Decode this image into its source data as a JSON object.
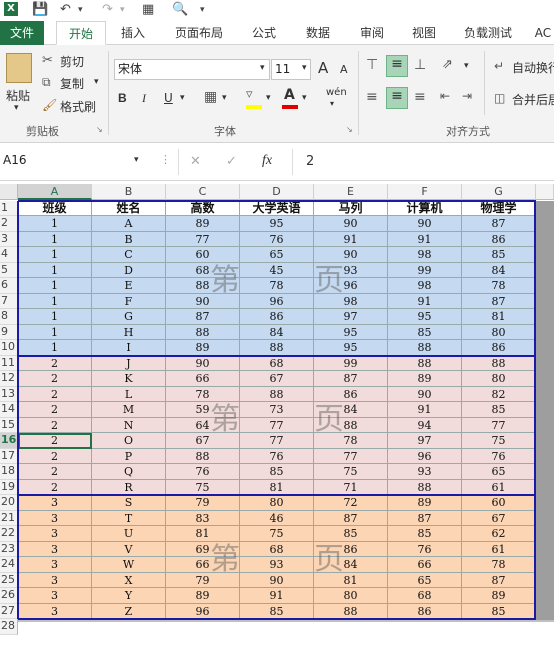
{
  "quick_access": {
    "excel_icon": "excel-app-icon",
    "save_icon": "save-icon",
    "undo_icon": "undo-icon",
    "redo_icon": "redo-icon",
    "print_preview_icon": "print-preview-icon",
    "customize_icon": "customize-qa-icon"
  },
  "tabs": [
    "文件",
    "开始",
    "插入",
    "页面布局",
    "公式",
    "数据",
    "审阅",
    "视图",
    "负载测试",
    "AC"
  ],
  "ribbon": {
    "clipboard": {
      "paste": "粘贴",
      "cut": "剪切",
      "copy": "复制",
      "format_painter": "格式刷",
      "group": "剪贴板"
    },
    "font": {
      "name": "宋体",
      "size": "11",
      "bold": "B",
      "italic": "I",
      "underline": "U",
      "grow": "A",
      "shrink": "A",
      "phonetic": "wén",
      "group": "字体"
    },
    "alignment": {
      "wrap": "自动换行",
      "merge": "合并后居",
      "group": "对齐方式"
    }
  },
  "formula_bar": {
    "name_box": "A16",
    "fx": "fx",
    "value": "2"
  },
  "sheet": {
    "columns": [
      "A",
      "B",
      "C",
      "D",
      "E",
      "F",
      "G"
    ],
    "header_row": [
      "班级",
      "姓名",
      "高数",
      "大学英语",
      "马列",
      "计算机",
      "物理学"
    ],
    "rows": [
      [
        "1",
        "A",
        "89",
        "95",
        "90",
        "90",
        "87"
      ],
      [
        "1",
        "B",
        "77",
        "76",
        "91",
        "91",
        "86"
      ],
      [
        "1",
        "C",
        "60",
        "65",
        "90",
        "98",
        "85"
      ],
      [
        "1",
        "D",
        "68",
        "45",
        "93",
        "99",
        "84"
      ],
      [
        "1",
        "E",
        "88",
        "78",
        "96",
        "98",
        "78"
      ],
      [
        "1",
        "F",
        "90",
        "96",
        "98",
        "91",
        "87"
      ],
      [
        "1",
        "G",
        "87",
        "86",
        "97",
        "95",
        "81"
      ],
      [
        "1",
        "H",
        "88",
        "84",
        "95",
        "85",
        "80"
      ],
      [
        "1",
        "I",
        "89",
        "88",
        "95",
        "88",
        "86"
      ],
      [
        "2",
        "J",
        "90",
        "68",
        "99",
        "88",
        "88"
      ],
      [
        "2",
        "K",
        "66",
        "67",
        "87",
        "89",
        "80"
      ],
      [
        "2",
        "L",
        "78",
        "88",
        "86",
        "90",
        "82"
      ],
      [
        "2",
        "M",
        "59",
        "73",
        "84",
        "91",
        "85"
      ],
      [
        "2",
        "N",
        "64",
        "77",
        "88",
        "94",
        "77"
      ],
      [
        "2",
        "O",
        "67",
        "77",
        "78",
        "97",
        "75"
      ],
      [
        "2",
        "P",
        "88",
        "76",
        "77",
        "96",
        "76"
      ],
      [
        "2",
        "Q",
        "76",
        "85",
        "75",
        "93",
        "65"
      ],
      [
        "2",
        "R",
        "75",
        "81",
        "71",
        "88",
        "61"
      ],
      [
        "3",
        "S",
        "79",
        "80",
        "72",
        "89",
        "60"
      ],
      [
        "3",
        "T",
        "83",
        "46",
        "87",
        "87",
        "67"
      ],
      [
        "3",
        "U",
        "81",
        "75",
        "85",
        "85",
        "62"
      ],
      [
        "3",
        "V",
        "69",
        "68",
        "86",
        "76",
        "61"
      ],
      [
        "3",
        "W",
        "66",
        "93",
        "84",
        "66",
        "78"
      ],
      [
        "3",
        "X",
        "79",
        "90",
        "81",
        "65",
        "87"
      ],
      [
        "3",
        "Y",
        "89",
        "91",
        "80",
        "68",
        "89"
      ],
      [
        "3",
        "Z",
        "96",
        "85",
        "88",
        "86",
        "85"
      ]
    ],
    "row_numbers": [
      "1",
      "2",
      "3",
      "4",
      "5",
      "6",
      "7",
      "8",
      "9",
      "10",
      "11",
      "12",
      "13",
      "14",
      "15",
      "16",
      "17",
      "18",
      "19",
      "20",
      "21",
      "22",
      "23",
      "24",
      "25",
      "26",
      "27",
      "28"
    ],
    "selected_row": "16",
    "selected_col": "A",
    "watermarks": [
      {
        "first": "第",
        "last": "页"
      },
      {
        "first": "第",
        "last": "页"
      },
      {
        "first": "第",
        "last": "页"
      }
    ],
    "colors": {
      "group1": "#c5d9f1",
      "group2": "#f2dcdb",
      "group3": "#fcd5b4",
      "page_break": "#1a1aa6",
      "accent": "#217346"
    }
  }
}
